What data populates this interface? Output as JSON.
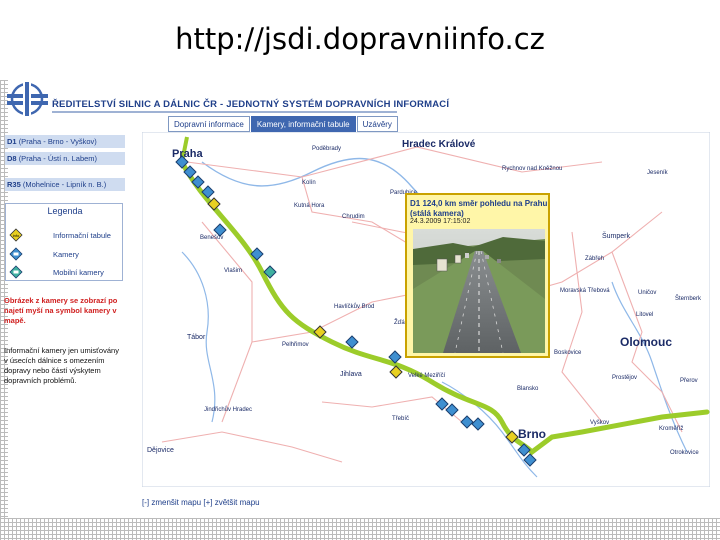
{
  "slide": {
    "title": "http://jsdi.dopravniinfo.cz"
  },
  "site": {
    "title": "ŘEDITELSTVÍ SILNIC A DÁLNIC ČR - JEDNOTNÝ SYSTÉM DOPRAVNÍCH INFORMACÍ"
  },
  "tabs": [
    {
      "label": "Dopravní informace",
      "active": false
    },
    {
      "label": "Kamery, informační tabule",
      "active": true
    },
    {
      "label": "Uzávěry",
      "active": false
    }
  ],
  "sidebar": {
    "roads": [
      {
        "code": "D1",
        "desc": "(Praha - Brno - Vyškov)"
      },
      {
        "code": "D8",
        "desc": "(Praha - Ústí n. Labem)"
      },
      {
        "code": "R35",
        "desc": "(Mohelnice - Lipník n. B.)"
      }
    ],
    "legend": {
      "title": "Legenda",
      "items": [
        {
          "label": "Informační tabule",
          "icon": "info-board-icon"
        },
        {
          "label": "Kamery",
          "icon": "camera-icon"
        },
        {
          "label": "Mobilní kamery",
          "icon": "mobile-camera-icon"
        }
      ]
    },
    "note_red": "Obrázek z kamery se zobrazí po najetí myší na symbol kamery v mapě.",
    "note_black": "Informační kamery jen umisťovány v úsecích dálnice s omezením dopravy nebo částí výskytem dopravních problémů."
  },
  "map": {
    "cities": [
      "Praha",
      "Hradec Králové",
      "Poděbrady",
      "Rychnov nad Kněžnou",
      "Jeseník",
      "Kolín",
      "Kutná Hora",
      "Pardubice",
      "Chrudim",
      "Šumperk",
      "Zábřeh",
      "Benešov",
      "Vlašim",
      "Havlíčkův Brod",
      "Moravská Třebová",
      "Uničov",
      "Šternberk",
      "Litovel",
      "Olomouc",
      "Tábor",
      "Pelhřimov",
      "Žďár",
      "Boskovice",
      "Prostějov",
      "Přerov",
      "Jihlava",
      "Velké Meziříčí",
      "Blansko",
      "Jindřichův Hradec",
      "Třebíč",
      "Vyškov",
      "Kroměříž",
      "Brno",
      "Otrokovice",
      "Dějovice"
    ],
    "route_color": "#9ccc2a",
    "footer": "[-] zmenšit mapu [+] zvětšit mapu"
  },
  "popup": {
    "title": "D1 124,0 km směr pohledu na Prahu (stálá kamera)",
    "date": "24.3.2009 17:15:02"
  },
  "colors": {
    "accent": "#1f3f8a",
    "tab_active": "#3f67b0",
    "sidebar_bg": "#cfdcf0",
    "note_red": "#d02020",
    "popup_bg": "#fff6a8"
  }
}
